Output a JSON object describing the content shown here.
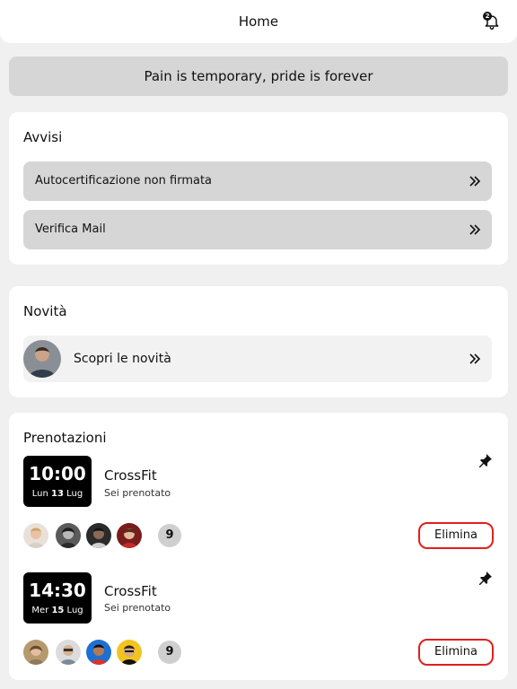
{
  "header": {
    "title": "Home",
    "notifications_count": "2"
  },
  "motto": "Pain is temporary, pride is forever",
  "avvisi": {
    "title": "Avvisi",
    "items": [
      {
        "label": "Autocertificazione non firmata"
      },
      {
        "label": "Verifica Mail"
      }
    ]
  },
  "novita": {
    "title": "Novità",
    "item_label": "Scopri le novità"
  },
  "prenotazioni": {
    "title": "Prenotazioni",
    "bookings": [
      {
        "time": "10:00",
        "day": "Lun",
        "date_num": "13",
        "month": "Lug",
        "name": "CrossFit",
        "status": "Sei prenotato",
        "attendee_count": "9",
        "delete_label": "Elimina"
      },
      {
        "time": "14:30",
        "day": "Mer",
        "date_num": "15",
        "month": "Lug",
        "name": "CrossFit",
        "status": "Sei prenotato",
        "attendee_count": "9",
        "delete_label": "Elimina"
      }
    ]
  },
  "colors": {
    "accent_red": "#e0201f",
    "button_gray": "#d6d6d6",
    "time_box": "#000000"
  }
}
